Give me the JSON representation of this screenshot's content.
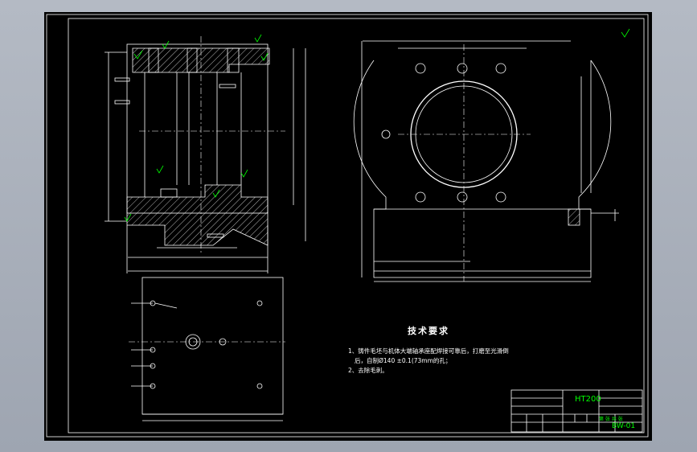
{
  "title_block": {
    "material": "HT200",
    "drawing_number": "BW-01",
    "designer_line": "第  张  共  张"
  },
  "tech_req": {
    "heading": "技术要求",
    "line1": "1、铸件毛坯与机体大端轴承座配焊接可靠后，打磨至光滑倒",
    "line2": "后，自制Ø140 ±0.1(73mm的孔；",
    "line3": "2、去除毛刺。"
  },
  "colors": {
    "canvas": "#000000",
    "line": "#ffffff",
    "annotation": "#00ff00",
    "frame_bg": "#9aa1ad"
  }
}
